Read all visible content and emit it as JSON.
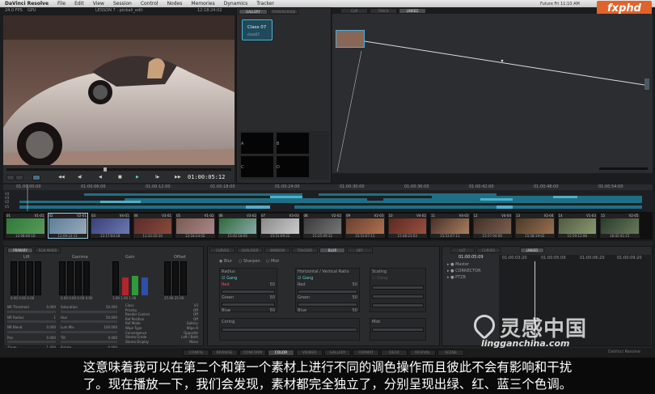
{
  "menubar": {
    "app": "DaVinci Resolve",
    "items": [
      "File",
      "Edit",
      "View",
      "Session",
      "Control",
      "Nodes",
      "Memories",
      "Dynamics",
      "Tracker"
    ],
    "clock": "Fri 11:10 AM",
    "right": "Future"
  },
  "logo": "fxphd",
  "viewer": {
    "fps": "24.0 FPS",
    "gpu": "GPU",
    "lesson": "LESSON 7 : pinball_edit",
    "timecode_top": "12:18:24:02",
    "timecode": "01:00:05:12"
  },
  "gallery": {
    "tabs": [
      "GALLERY",
      "POWERGRADE"
    ],
    "still_label": "Class 07",
    "still_sub": "class07",
    "cells": [
      "A",
      "B",
      "C",
      "D"
    ]
  },
  "nodes": {
    "tabs": [
      "CLIP",
      "TRACK",
      "LINKED"
    ]
  },
  "timeline": {
    "ruler": [
      "01:00:00:00",
      "01:00:06:00",
      "01:00:12:00",
      "01:00:18:00",
      "01:00:24:00",
      "01:00:30:00",
      "01:00:36:00",
      "01:00:42:00",
      "01:00:48:00",
      "01:00:54:00"
    ],
    "tracks": [
      "V4",
      "V3",
      "V2",
      "V1"
    ]
  },
  "clips": [
    {
      "num": "01",
      "track": "V1-01",
      "tc": "12:08:06:10"
    },
    {
      "num": "02",
      "track": "V2-01",
      "tc": "12:09:22:11"
    },
    {
      "num": "03",
      "track": "V4-01",
      "tc": "12:17:04:18"
    },
    {
      "num": "04",
      "track": "V3-01",
      "tc": "11:22:20:10"
    },
    {
      "num": "05",
      "track": "V1-02",
      "tc": "12:18:24:02"
    },
    {
      "num": "06",
      "track": "V3-02",
      "tc": "15:42:18:05"
    },
    {
      "num": "07",
      "track": "V3-03",
      "tc": "15:51:09:22"
    },
    {
      "num": "08",
      "track": "V2-02",
      "tc": "15:25:49:12"
    },
    {
      "num": "09",
      "track": "V2-03",
      "tc": "15:53:07:11"
    },
    {
      "num": "10",
      "track": "V4-02",
      "tc": "15:48:23:03"
    },
    {
      "num": "11",
      "track": "V4-03",
      "tc": "15:53:07:11"
    },
    {
      "num": "12",
      "track": "V4-04",
      "tc": "15:57:04:06"
    },
    {
      "num": "13",
      "track": "V2-04",
      "tc": "15:58:19:02"
    },
    {
      "num": "14",
      "track": "V1-03",
      "tc": "15:59:12:08"
    },
    {
      "num": "15",
      "track": "V2-05",
      "tc": "16:02:41:15"
    }
  ],
  "primary": {
    "tabs": [
      "PRIMARY",
      "RGB MIXER"
    ],
    "wheels": [
      "Lift",
      "Gamma",
      "Gain",
      "Offset"
    ],
    "values": [
      "0.00",
      "0.00",
      "0.00",
      "0.00",
      "0.00",
      "0.00",
      "0.00",
      "1.00",
      "1.00",
      "1.00",
      "25.00",
      "25.00"
    ],
    "params_left": [
      {
        "k": "NR Threshold",
        "v": "0.000"
      },
      {
        "k": "NR Radius",
        "v": "1"
      },
      {
        "k": "NR Blend",
        "v": "0.000"
      },
      {
        "k": "Pan",
        "v": "0.000"
      },
      {
        "k": "Zoom",
        "v": "1.000"
      }
    ],
    "params_mid": [
      {
        "k": "Saturation",
        "v": "50.000"
      },
      {
        "k": "Hue",
        "v": "50.000"
      },
      {
        "k": "Lum Mix",
        "v": "100.000"
      },
      {
        "k": "Tilt",
        "v": "0.000"
      },
      {
        "k": "Rotate",
        "v": "0.000"
      }
    ],
    "info": [
      {
        "k": "Class",
        "v": "V3"
      },
      {
        "k": "Priority",
        "v": "Off"
      },
      {
        "k": "Render Control",
        "v": "Off"
      },
      {
        "k": "Ref Position",
        "v": "Off"
      },
      {
        "k": "Ref Mode",
        "v": "Gallery"
      },
      {
        "k": "Wipe Type",
        "v": "Wipe H"
      },
      {
        "k": "Convergence",
        "v": "Opposite"
      },
      {
        "k": "Stereo Grade",
        "v": "Left / Both"
      },
      {
        "k": "Stereo Display",
        "v": "Mono"
      }
    ]
  },
  "blur": {
    "tabs": [
      "CURVES",
      "QUALIFIER",
      "WINDOW",
      "TRACKER",
      "BLUR",
      "KEY"
    ],
    "modes": [
      "Blur",
      "Sharpen",
      "Mist"
    ],
    "radius": "Radius",
    "hv": "Horizontal / Vertical Ratio",
    "scaling": "Scaling",
    "gang": "Gang",
    "rows": [
      "Red",
      "Green",
      "Blue"
    ],
    "val": "50",
    "coring": "Coring",
    "mist": "Mist"
  },
  "nodelist": {
    "tabs": [
      "LUT",
      "CURVES",
      "LINKED"
    ],
    "tc": "01:00:05:09",
    "items": [
      "Master",
      "CORRECTOR",
      "PTZR"
    ],
    "ruler": [
      "01:00:03:20",
      "01:00:05:09",
      "01:00:06:20",
      "01:00:09:20"
    ]
  },
  "footer": {
    "tabs": [
      "CONFIG",
      "BROWSE",
      "CONFORM",
      "COLOR",
      "VIEWER",
      "GALLERY",
      "FORMAT",
      "DECK",
      "REVIVAL",
      "SCENE"
    ],
    "active": "COLOR",
    "brand": "DaVinci Resolve"
  },
  "watermark": {
    "cn": "灵感中国",
    "en": "lingganchina.com"
  },
  "subtitle": {
    "line1": "这意味着我可以在第二个和第一个素材上进行不同的调色操作而且彼此不会有影响和干扰",
    "line2": "了。现在播放一下，我们会发现，素材都完全独立了，分别呈现出绿、红、蓝三个色调。"
  }
}
